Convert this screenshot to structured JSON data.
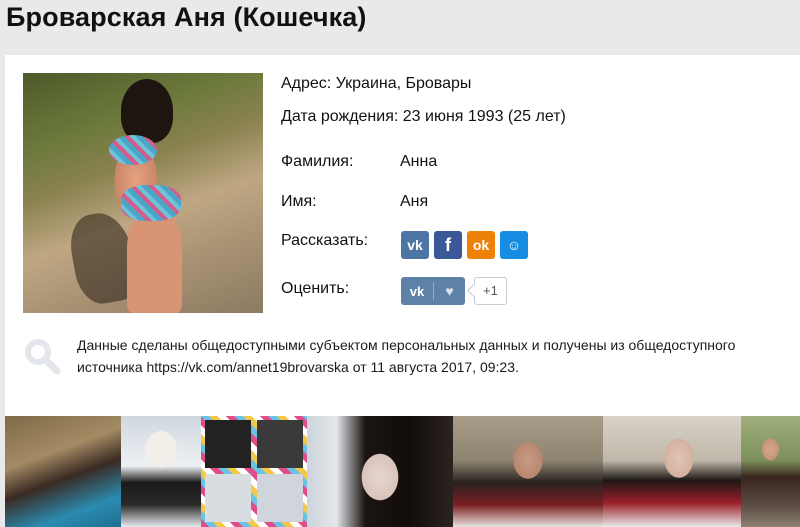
{
  "profile": {
    "title": "Броварская Аня (Кошечка)",
    "address": "Адрес: Украина, Бровары",
    "birthdate": "Дата рождения: 23 июня 1993 (25 лет)",
    "surname_label": "Фамилия:",
    "surname_value": "Анна",
    "name_label": "Имя:",
    "name_value": "Аня",
    "share_label": "Рассказать:",
    "rate_label": "Оценить:"
  },
  "share_buttons": [
    {
      "network": "vk",
      "glyph": "vk",
      "color": "#4c75a3"
    },
    {
      "network": "facebook",
      "glyph": "f",
      "color": "#3b5998"
    },
    {
      "network": "odnoklassniki",
      "glyph": "ok",
      "color": "#ee8208"
    },
    {
      "network": "moimir",
      "glyph": "☺",
      "color": "#168de2"
    }
  ],
  "like_widget": {
    "vk_glyph": "vk",
    "heart_glyph": "♥",
    "counter": "+1"
  },
  "notice": {
    "text": "Данные сделаны общедоступными субъектом персональных данных и получены из общедоступного источника https://vk.com/annet19brovarska от 11 августа 2017, 09:23."
  },
  "icons": {
    "search": "magnifier-icon",
    "heart": "heart-icon"
  },
  "colors": {
    "background": "#e9e9ec",
    "vk": "#4c75a3",
    "facebook": "#3b5998",
    "odnoklassniki": "#ee8208",
    "moimir": "#168de2"
  }
}
